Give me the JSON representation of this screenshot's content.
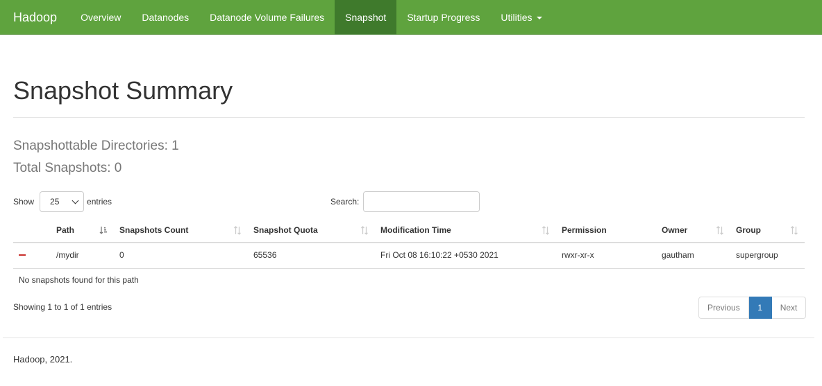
{
  "nav": {
    "brand": "Hadoop",
    "items": [
      {
        "label": "Overview"
      },
      {
        "label": "Datanodes"
      },
      {
        "label": "Datanode Volume Failures"
      },
      {
        "label": "Snapshot",
        "active": true
      },
      {
        "label": "Startup Progress"
      },
      {
        "label": "Utilities"
      }
    ],
    "color": "#5fa33e",
    "active_color": "#3f7a2c"
  },
  "page": {
    "title": "Snapshot Summary",
    "snapshottable": "Snapshottable Directories: 1",
    "total": "Total Snapshots: 0"
  },
  "table_controls": {
    "show_label": "Show",
    "entries_label": "entries",
    "page_length": "25",
    "search_label": "Search:",
    "search_value": ""
  },
  "table": {
    "columns": [
      "Path",
      "Snapshots Count",
      "Snapshot Quota",
      "Modification Time",
      "Permission",
      "Owner",
      "Group"
    ],
    "rows": [
      {
        "path": "/mydir",
        "count": "0",
        "quota": "65536",
        "mtime": "Fri Oct 08 16:10:22 +0530 2021",
        "permission": "rwxr-xr-x",
        "owner": "gautham",
        "group": "supergroup"
      }
    ],
    "child_text": "No snapshots found for this path"
  },
  "pagination": {
    "info": "Showing 1 to 1 of 1 entries",
    "previous": "Previous",
    "current": "1",
    "next": "Next"
  },
  "footer": {
    "text": "Hadoop, 2021."
  }
}
